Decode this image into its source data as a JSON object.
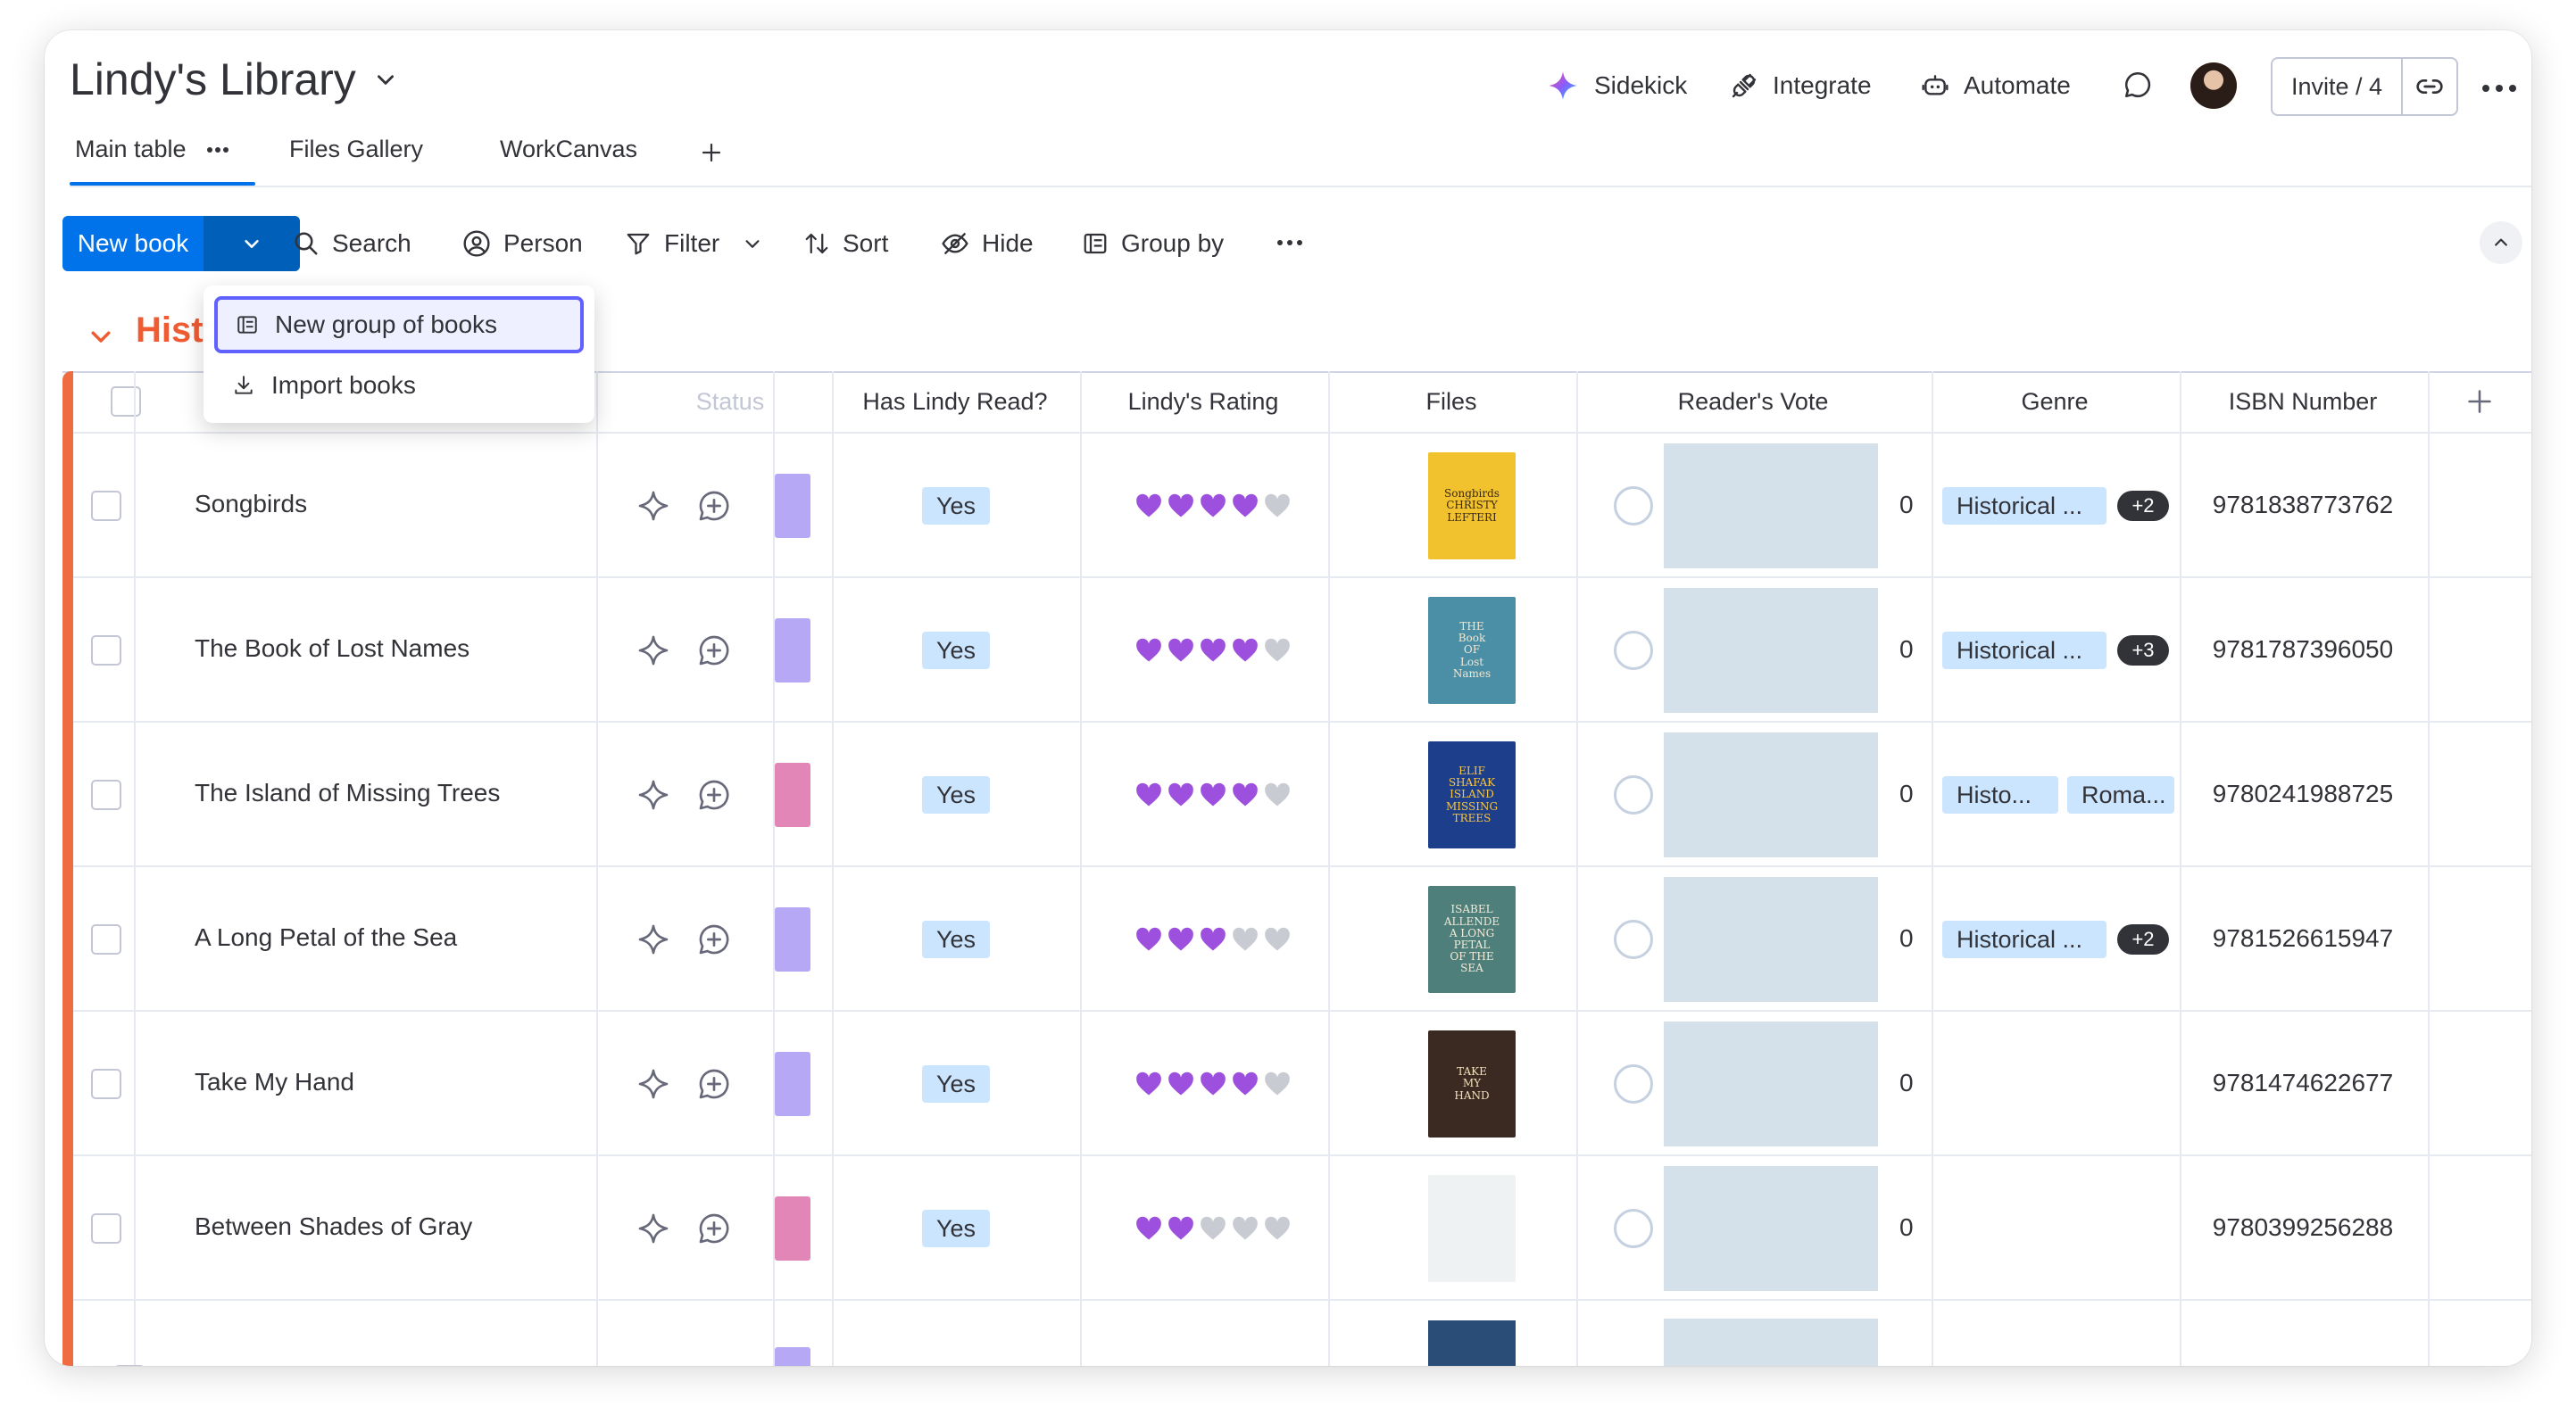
{
  "board": {
    "title": "Lindy's Library"
  },
  "header": {
    "sidekick": "Sidekick",
    "integrate": "Integrate",
    "automate": "Automate",
    "invite": "Invite / 4"
  },
  "tabs": [
    {
      "label": "Main table",
      "active": true
    },
    {
      "label": "Files Gallery"
    },
    {
      "label": "WorkCanvas"
    }
  ],
  "toolbar": {
    "new_button": "New book",
    "search": "Search",
    "person": "Person",
    "filter": "Filter",
    "sort": "Sort",
    "hide": "Hide",
    "group_by": "Group by"
  },
  "dropdown": {
    "items": [
      {
        "label": "New group of books",
        "icon": "group-icon",
        "highlighted": true
      },
      {
        "label": "Import books",
        "icon": "download-icon"
      }
    ]
  },
  "group": {
    "title_visible": "Histo",
    "color": "#ef5c33"
  },
  "table": {
    "columns": {
      "status": "Status",
      "has_read": "Has Lindy Read?",
      "rating": "Lindy's Rating",
      "files": "Files",
      "vote": "Reader's Vote",
      "genre": "Genre",
      "isbn": "ISBN Number"
    },
    "rows": [
      {
        "name": "Songbirds",
        "status_color": "#b6a8f5",
        "has_read": "Yes",
        "rating": 4,
        "cover_text": "Songbirds\nCHRISTY LEFTERI",
        "vote": "0",
        "genres": [
          "Historical ..."
        ],
        "genre_more": "+2",
        "isbn": "9781838773762"
      },
      {
        "name": "The Book of Lost Names",
        "status_color": "#b6a8f5",
        "has_read": "Yes",
        "rating": 4,
        "cover_text": "THE\nBook\nOF\nLost\nNames",
        "vote": "0",
        "genres": [
          "Historical ..."
        ],
        "genre_more": "+3",
        "isbn": "9781787396050"
      },
      {
        "name": "The Island of Missing Trees",
        "status_color": "#e285b7",
        "has_read": "Yes",
        "rating": 4,
        "cover_text": "ELIF\nSHAFAK\nISLAND\nMISSING\nTREES",
        "vote": "0",
        "genres": [
          "Histo...",
          "Roma..."
        ],
        "genre_more": "",
        "isbn": "9780241988725"
      },
      {
        "name": "A Long Petal of the Sea",
        "status_color": "#b6a8f5",
        "has_read": "Yes",
        "rating": 3,
        "cover_text": "ISABEL\nALLENDE\nA LONG\nPETAL\nOF THE\nSEA",
        "vote": "0",
        "genres": [
          "Historical ..."
        ],
        "genre_more": "+2",
        "isbn": "9781526615947"
      },
      {
        "name": "Take My Hand",
        "status_color": "#b6a8f5",
        "has_read": "Yes",
        "rating": 4,
        "cover_text": "TAKE\nMY\nHAND",
        "vote": "0",
        "genres": [],
        "genre_more": "",
        "isbn": "9781474622677"
      },
      {
        "name": "Between Shades of Gray",
        "status_color": "#e285b7",
        "has_read": "Yes",
        "rating": 2,
        "cover_text": "",
        "vote": "0",
        "genres": [],
        "genre_more": "",
        "isbn": "9780399256288"
      }
    ],
    "rating_max": 5,
    "colors": {
      "heart_on": "#9d50dd",
      "heart_off": "#c9cbd2",
      "yes_bg": "#cce5ff",
      "genre_bg": "#cce5ff"
    }
  }
}
